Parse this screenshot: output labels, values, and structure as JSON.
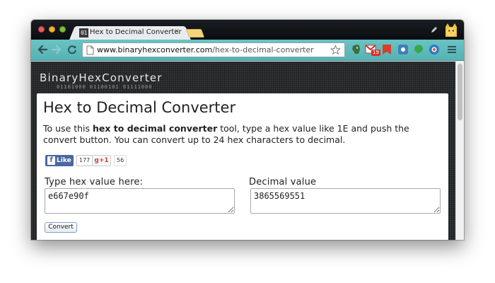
{
  "browser": {
    "tab": {
      "favicon_text": "01",
      "title": "Hex to Decimal Converter",
      "close": "×"
    },
    "url": {
      "host": "www.binaryhexconverter.com",
      "path": "/hex-to-decimal-converter"
    },
    "extensions": {
      "gmail_badge": "19"
    },
    "colors": {
      "toolbar": "#5ebbbd",
      "titlebar": "#111417"
    }
  },
  "site": {
    "logo": "BinaryHexConverter",
    "binary_tagline": "01101000 01100101 01111000"
  },
  "page": {
    "title": "Hex to Decimal Converter",
    "intro_before": "To use this ",
    "intro_bold": "hex to decimal converter",
    "intro_after": " tool, type a hex value like 1E and push the convert button. You can convert up to 24 hex characters to decimal.",
    "social": {
      "fb_label": "Like",
      "fb_count": "177",
      "gplus_label": "g+1",
      "gplus_count": "56"
    },
    "hex_label": "Type hex value here:",
    "hex_value": "e667e90f",
    "decimal_label": "Decimal value",
    "decimal_value": "3865569551",
    "convert_label": "Convert"
  }
}
